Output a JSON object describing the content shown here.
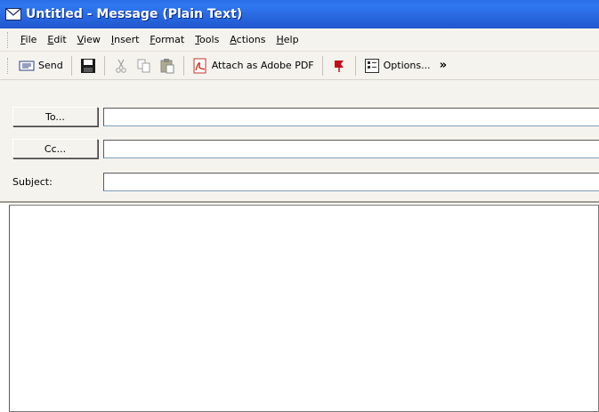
{
  "window": {
    "title": "Untitled - Message (Plain Text)",
    "title_icon": "envelope-icon"
  },
  "menubar": {
    "items": [
      {
        "id": "file",
        "label": "File"
      },
      {
        "id": "edit",
        "label": "Edit"
      },
      {
        "id": "view",
        "label": "View"
      },
      {
        "id": "insert",
        "label": "Insert"
      },
      {
        "id": "format",
        "label": "Format"
      },
      {
        "id": "tools",
        "label": "Tools"
      },
      {
        "id": "actions",
        "label": "Actions"
      },
      {
        "id": "help",
        "label": "Help"
      }
    ]
  },
  "toolbar": {
    "send_label": "Send",
    "attach_pdf_label": "Attach as Adobe PDF",
    "options_label": "Options...",
    "more_label": "»"
  },
  "header": {
    "to_label": "To...",
    "cc_label": "Cc...",
    "subject_label": "Subject:",
    "to_value": "",
    "cc_value": "",
    "subject_value": ""
  },
  "message": {
    "body": ""
  },
  "colors": {
    "titlebar": "#2a69e0",
    "chrome": "#f4f3ee",
    "field_border": "#7f9db9"
  }
}
